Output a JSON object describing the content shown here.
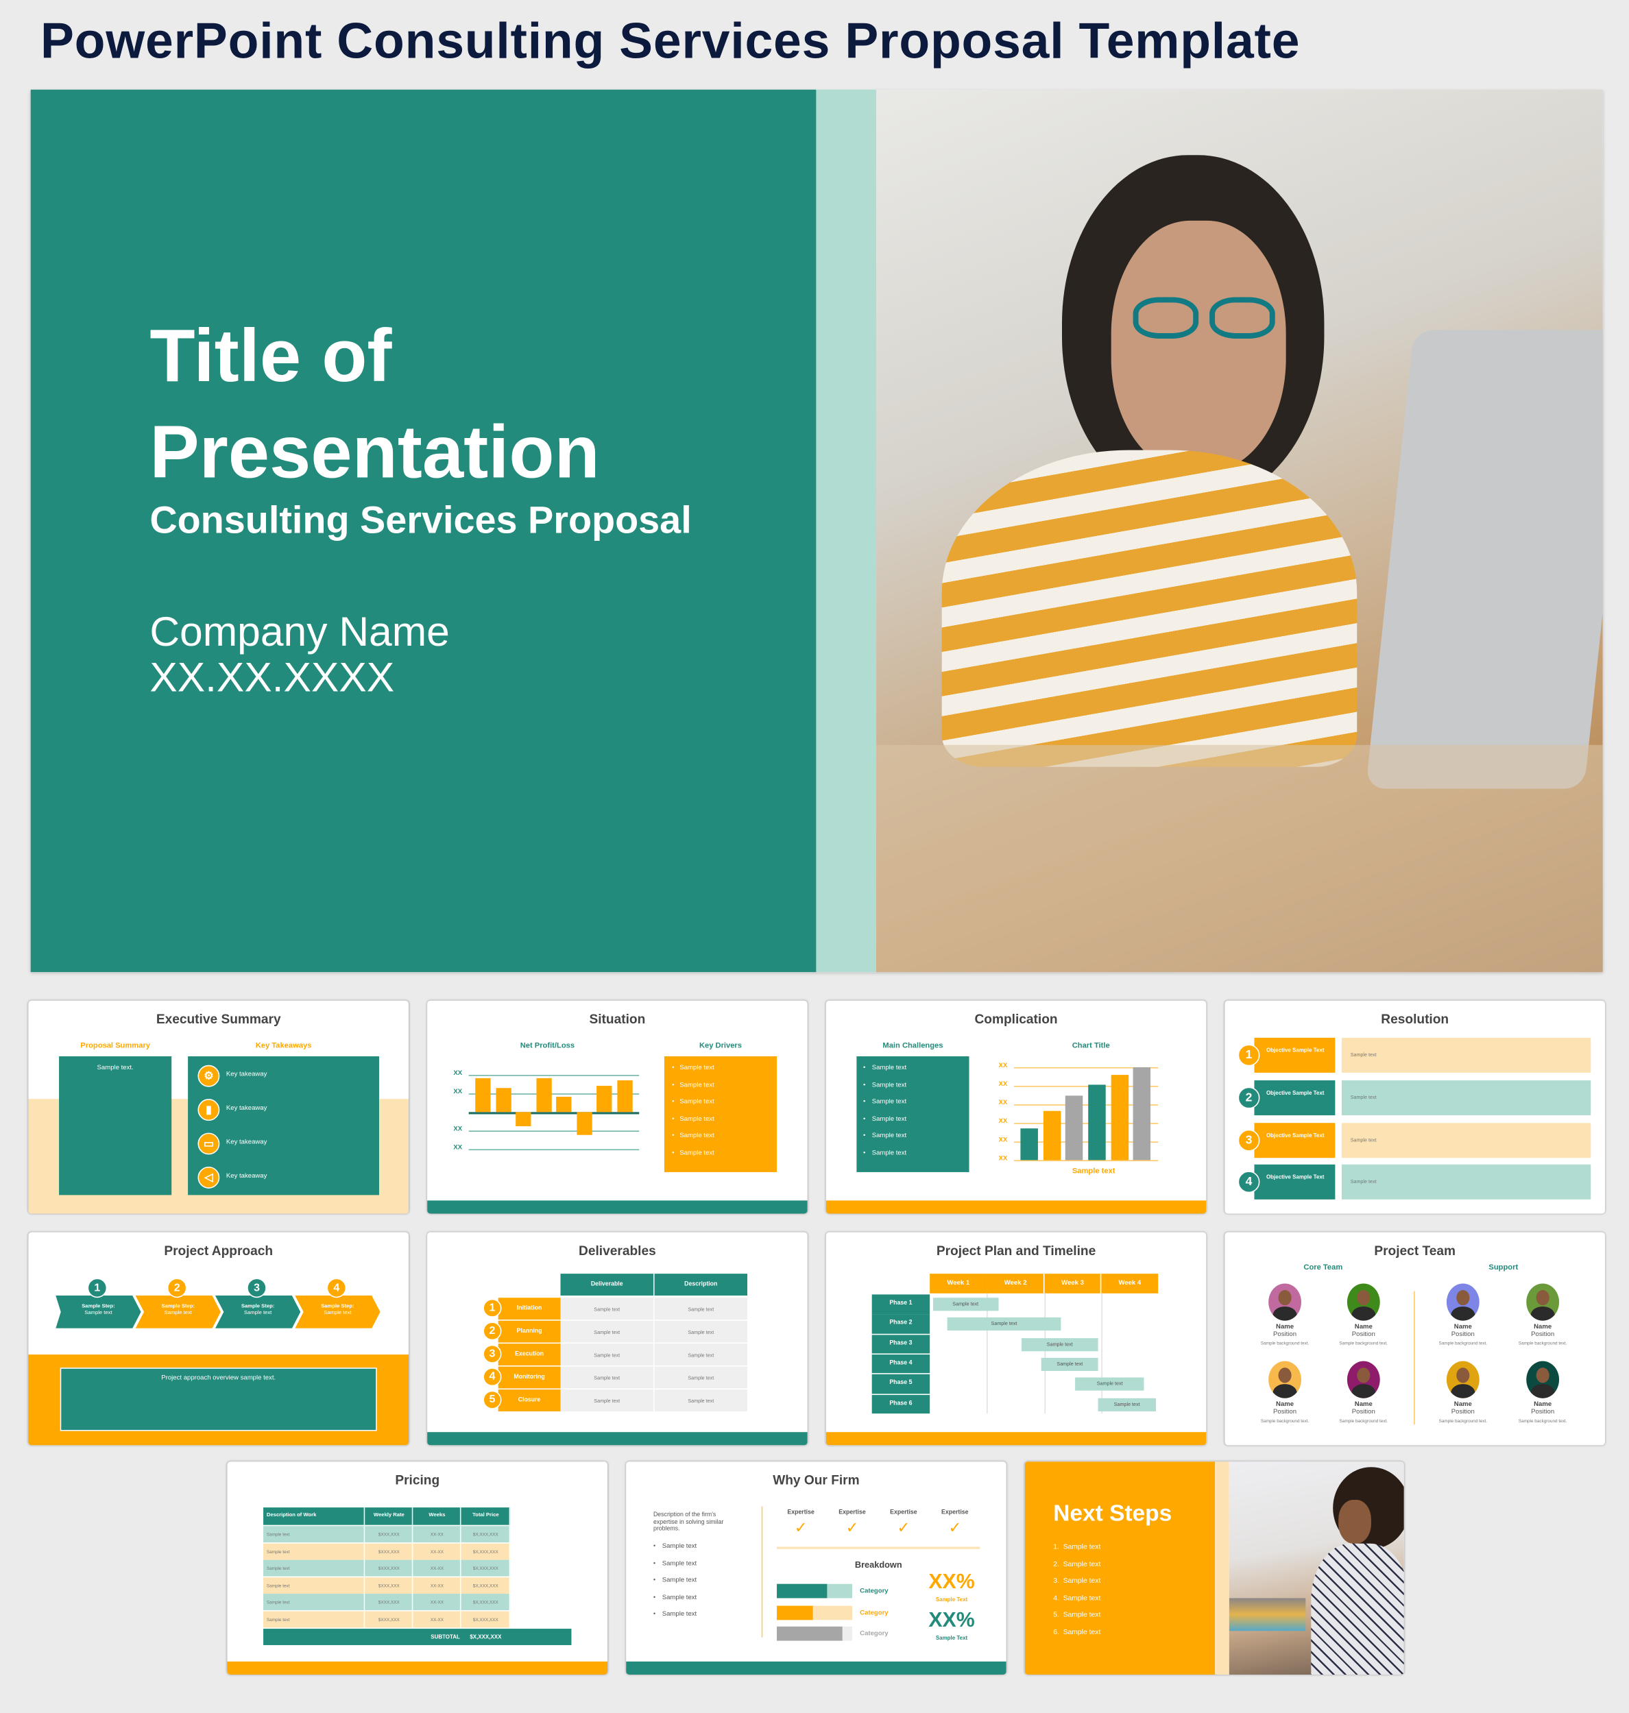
{
  "page_title": "PowerPoint Consulting Services Proposal Template",
  "colors": {
    "teal": "#228b7b",
    "orange": "#ffa800",
    "light_teal": "#b0dcd2",
    "cream": "#fde3b3",
    "gray": "#a6a6a6",
    "navy": "#0c1a3e"
  },
  "hero": {
    "title_line1": "Title of",
    "title_line2": "Presentation",
    "subtitle": "Consulting Services Proposal",
    "company": "Company Name",
    "date": "XX.XX.XXXX",
    "photo": "woman-with-glasses-at-laptop-photo"
  },
  "executive_summary": {
    "title": "Executive Summary",
    "proposal_label": "Proposal Summary",
    "proposal_text": "Sample text.",
    "takeaways_label": "Key Takeaways",
    "takeaways": [
      {
        "icon": "gear-icon",
        "text": "Key takeaway"
      },
      {
        "icon": "bar-chart-icon",
        "text": "Key takeaway"
      },
      {
        "icon": "presentation-icon",
        "text": "Key takeaway"
      },
      {
        "icon": "megaphone-icon",
        "text": "Key takeaway"
      }
    ]
  },
  "situation": {
    "title": "Situation",
    "chart_label": "Net Profit/Loss",
    "drivers_label": "Key Drivers",
    "drivers": [
      "Sample text",
      "Sample text",
      "Sample text",
      "Sample text",
      "Sample text",
      "Sample text"
    ]
  },
  "complication": {
    "title": "Complication",
    "challenges_label": "Main Challenges",
    "challenges": [
      "Sample text",
      "Sample text",
      "Sample text",
      "Sample text",
      "Sample text",
      "Sample text"
    ],
    "chart_title": "Chart Title",
    "chart_caption": "Sample text"
  },
  "chart_data": [
    {
      "type": "bar",
      "title": "Net Profit/Loss",
      "values": [
        1.8,
        1.3,
        -0.75,
        1.85,
        0.8,
        -1.25,
        1.4,
        1.7
      ],
      "ytick_labels": [
        "XX",
        "XX",
        "XX",
        "XX"
      ],
      "ylim": [
        -2,
        2
      ],
      "grid": true,
      "color": "#ffa800"
    },
    {
      "type": "bar",
      "title": "Chart Title",
      "xlabel": "Sample text",
      "values": [
        1.7,
        2.65,
        3.5,
        4.05,
        4.6,
        5
      ],
      "colors": [
        "#228b7b",
        "#ffa800",
        "#a6a6a6",
        "#228b7b",
        "#ffa800",
        "#a6a6a6"
      ],
      "ytick_labels": [
        "XX",
        "XX",
        "XX",
        "XX",
        "XX",
        "XX"
      ],
      "ylim": [
        0,
        5
      ],
      "grid": true
    }
  ],
  "resolution": {
    "title": "Resolution",
    "items": [
      {
        "n": "1",
        "label": "Objective Sample Text",
        "text": "Sample text"
      },
      {
        "n": "2",
        "label": "Objective Sample Text",
        "text": "Sample text"
      },
      {
        "n": "3",
        "label": "Objective Sample Text",
        "text": "Sample text"
      },
      {
        "n": "4",
        "label": "Objective Sample Text",
        "text": "Sample text"
      }
    ]
  },
  "approach": {
    "title": "Project Approach",
    "steps": [
      {
        "n": "1",
        "label": "Sample Step:",
        "text": "Sample text"
      },
      {
        "n": "2",
        "label": "Sample Step:",
        "text": "Sample text"
      },
      {
        "n": "3",
        "label": "Sample Step:",
        "text": "Sample text"
      },
      {
        "n": "4",
        "label": "Sample Step:",
        "text": "Sample text"
      }
    ],
    "overview": "Project approach overview sample text."
  },
  "deliverables": {
    "title": "Deliverables",
    "headers": [
      "Deliverable",
      "Description"
    ],
    "rows": [
      {
        "n": "1",
        "name": "Initiation",
        "deliverable": "Sample text",
        "description": "Sample text"
      },
      {
        "n": "2",
        "name": "Planning",
        "deliverable": "Sample text",
        "description": "Sample text"
      },
      {
        "n": "3",
        "name": "Execution",
        "deliverable": "Sample text",
        "description": "Sample text"
      },
      {
        "n": "4",
        "name": "Monitoring",
        "deliverable": "Sample text",
        "description": "Sample text"
      },
      {
        "n": "5",
        "name": "Closure",
        "deliverable": "Sample text",
        "description": "Sample text"
      }
    ]
  },
  "timeline": {
    "title": "Project Plan and Timeline",
    "weeks": [
      "Week 1",
      "Week 2",
      "Week 3",
      "Week 4"
    ],
    "phases": [
      {
        "name": "Phase 1",
        "text": "Sample text",
        "start": 0.05,
        "end": 1.2
      },
      {
        "name": "Phase 2",
        "text": "Sample text",
        "start": 0.3,
        "end": 2.3
      },
      {
        "name": "Phase 3",
        "text": "Sample text",
        "start": 1.6,
        "end": 2.95
      },
      {
        "name": "Phase 4",
        "text": "Sample text",
        "start": 1.95,
        "end": 2.95
      },
      {
        "name": "Phase 5",
        "text": "Sample text",
        "start": 2.55,
        "end": 3.75
      },
      {
        "name": "Phase 6",
        "text": "Sample text",
        "start": 2.95,
        "end": 3.95
      }
    ]
  },
  "team": {
    "title": "Project Team",
    "groups": [
      {
        "label": "Core Team",
        "members": [
          {
            "name": "Name",
            "position": "Position",
            "bio": "Sample background text.",
            "bg": "#c06aa0"
          },
          {
            "name": "Name",
            "position": "Position",
            "bio": "Sample background text.",
            "bg": "#3e8a1a"
          },
          {
            "name": "Name",
            "position": "Position",
            "bio": "Sample background text.",
            "bg": "#f7b94c"
          },
          {
            "name": "Name",
            "position": "Position",
            "bio": "Sample background text.",
            "bg": "#8e1c6a"
          }
        ]
      },
      {
        "label": "Support",
        "members": [
          {
            "name": "Name",
            "position": "Position",
            "bio": "Sample background text.",
            "bg": "#7d86e6"
          },
          {
            "name": "Name",
            "position": "Position",
            "bio": "Sample background text.",
            "bg": "#6b9a3a"
          },
          {
            "name": "Name",
            "position": "Position",
            "bio": "Sample background text.",
            "bg": "#e0a410"
          },
          {
            "name": "Name",
            "position": "Position",
            "bio": "Sample background text.",
            "bg": "#0a4a40"
          }
        ]
      }
    ]
  },
  "pricing": {
    "title": "Pricing",
    "headers": [
      "Description of Work",
      "Weekly Rate",
      "Weeks",
      "Total Price"
    ],
    "rows": [
      [
        "Sample text",
        "$XXX,XXX",
        "XX-XX",
        "$X,XXX,XXX"
      ],
      [
        "Sample text",
        "$XXX,XXX",
        "XX-XX",
        "$X,XXX,XXX"
      ],
      [
        "Sample text",
        "$XXX,XXX",
        "XX-XX",
        "$X,XXX,XXX"
      ],
      [
        "Sample text",
        "$XXX,XXX",
        "XX-XX",
        "$X,XXX,XXX"
      ],
      [
        "Sample text",
        "$XXX,XXX",
        "XX-XX",
        "$X,XXX,XXX"
      ],
      [
        "Sample text",
        "$XXX,XXX",
        "XX-XX",
        "$X,XXX,XXX"
      ]
    ],
    "subtotal_label": "SUBTOTAL",
    "subtotal": "$X,XXX,XXX"
  },
  "why": {
    "title": "Why Our Firm",
    "description": "Description of the firm's expertise in solving similar problems.",
    "bullets": [
      "Sample text",
      "Sample text",
      "Sample text",
      "Sample text",
      "Sample text"
    ],
    "expertise": [
      "Expertise",
      "Expertise",
      "Expertise",
      "Expertise"
    ],
    "breakdown_label": "Breakdown",
    "categories": [
      {
        "label": "Category",
        "fill": 0.66,
        "color": "#228b7b",
        "bg": "#b0dcd2"
      },
      {
        "label": "Category",
        "fill": 0.48,
        "color": "#ffa800",
        "bg": "#fde3b3"
      },
      {
        "label": "Category",
        "fill": 0.87,
        "color": "#a6a6a6",
        "bg": "#eeeeee"
      }
    ],
    "stats": [
      {
        "value": "XX%",
        "label": "Sample Text",
        "color": "#ffa800"
      },
      {
        "value": "XX%",
        "label": "Sample Text",
        "color": "#228b7b"
      }
    ]
  },
  "next_steps": {
    "title": "Next Steps",
    "items": [
      "1.  Sample text",
      "2.  Sample text",
      "3.  Sample text",
      "4.  Sample text",
      "5.  Sample text",
      "6.  Sample text"
    ],
    "photo": "woman-with-swatches-at-desk-photo"
  }
}
